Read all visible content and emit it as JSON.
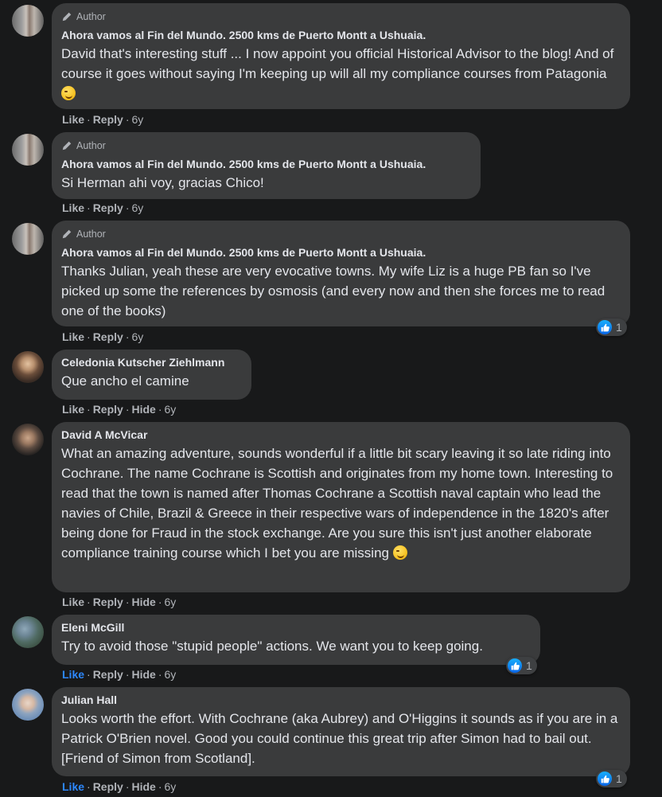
{
  "comments": [
    {
      "author_badge": "Author",
      "name": "Ahora vamos al Fin del Mundo. 2500 kms de Puerto Montt a Ushuaia.",
      "text": "David that's interesting stuff ... I now appoint you official Historical Advisor to the blog! And of course it goes without saying I'm keeping up will all my compliance courses from Patagonia",
      "emoji": "winking-face",
      "actions": {
        "like": "Like",
        "reply": "Reply",
        "time": "6y"
      }
    },
    {
      "author_badge": "Author",
      "name": "Ahora vamos al Fin del Mundo. 2500 kms de Puerto Montt a Ushuaia.",
      "text": "Si Herman ahi voy, gracias Chico!",
      "actions": {
        "like": "Like",
        "reply": "Reply",
        "time": "6y"
      }
    },
    {
      "author_badge": "Author",
      "name": "Ahora vamos al Fin del Mundo. 2500 kms de Puerto Montt a Ushuaia.",
      "text": "Thanks Julian, yeah these are very evocative towns. My wife Liz is a huge PB fan so I've picked up some the references by osmosis (and every now and then she forces me to read one of the books)",
      "actions": {
        "like": "Like",
        "reply": "Reply",
        "time": "6y"
      },
      "reaction_count": "1"
    },
    {
      "name": "Celedonia Kutscher Ziehlmann",
      "text": "Que ancho el camine",
      "actions": {
        "like": "Like",
        "reply": "Reply",
        "hide": "Hide",
        "time": "6y"
      }
    },
    {
      "name": "David A McVicar",
      "text": "What an amazing adventure, sounds wonderful if a little bit scary leaving it so late riding into Cochrane. The name Cochrane is Scottish and originates from my home town. Interesting to read that the town is named after Thomas Cochrane a Scottish naval captain who lead the navies of Chile, Brazil & Greece in their respective wars of independence in the 1820's after being done for Fraud in the stock exchange. Are you sure this isn't just another elaborate compliance training course which I bet you are missing",
      "emoji": "winking-face",
      "actions": {
        "like": "Like",
        "reply": "Reply",
        "hide": "Hide",
        "time": "6y"
      }
    },
    {
      "name": "Eleni McGill",
      "text": "Try to avoid those \"stupid people\" actions. We want you to keep going.",
      "actions": {
        "like": "Like",
        "reply": "Reply",
        "hide": "Hide",
        "time": "6y"
      },
      "reaction_count": "1",
      "liked": true
    },
    {
      "name": "Julian Hall",
      "text": "Looks worth the effort. With Cochrane (aka Aubrey) and O'Higgins it sounds as if you are in a Patrick O'Brien novel. Good you could continue this great trip after Simon had to bail out. [Friend of Simon from Scotland].",
      "actions": {
        "like": "Like",
        "reply": "Reply",
        "hide": "Hide",
        "time": "6y"
      },
      "reaction_count": "1",
      "liked": true
    }
  ],
  "colors": {
    "background": "#18191a",
    "bubble": "#3a3b3c",
    "text": "#e4e6eb",
    "secondary_text": "#b0b3b8",
    "like_blue": "#2d88ff"
  }
}
